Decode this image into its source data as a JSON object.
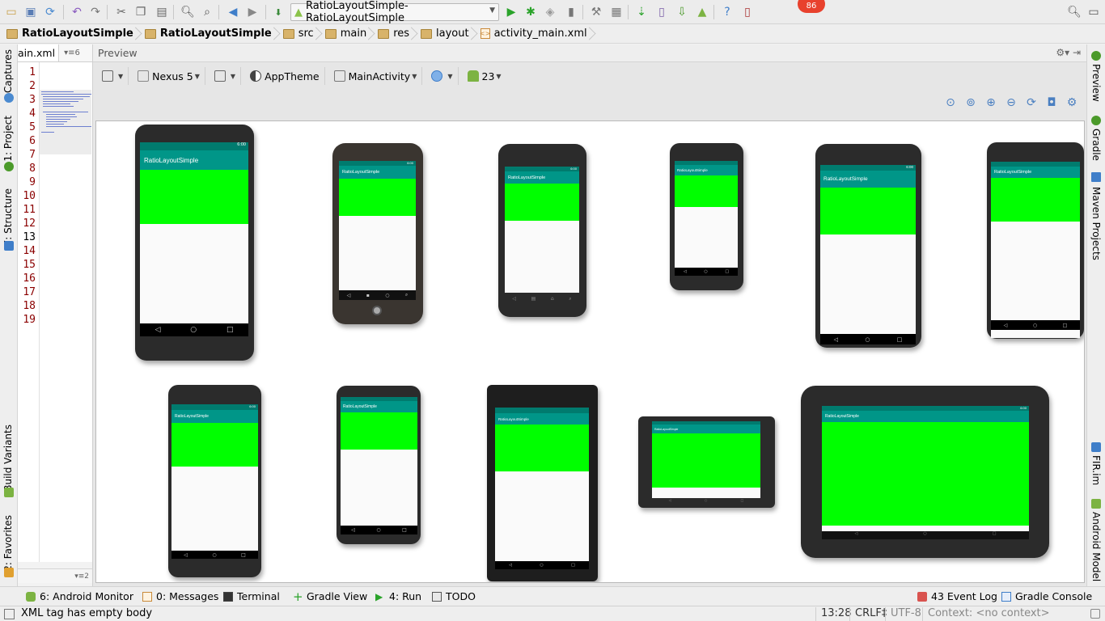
{
  "toolbar": {
    "run_config": "RatioLayoutSimple-RatioLayoutSimple",
    "notification_count": "86"
  },
  "breadcrumb": [
    {
      "label": "RatioLayoutSimple",
      "bold": true
    },
    {
      "label": "RatioLayoutSimple",
      "bold": true
    },
    {
      "label": "src",
      "bold": false
    },
    {
      "label": "main",
      "bold": false
    },
    {
      "label": "res",
      "bold": false
    },
    {
      "label": "layout",
      "bold": false
    },
    {
      "label": "activity_main.xml",
      "bold": false
    }
  ],
  "left_tool_tabs": {
    "captures": "Captures",
    "project": "1: Project",
    "structure": "7: Structure",
    "build_variants": "Build Variants",
    "favorites": "2: Favorites"
  },
  "right_tool_tabs": {
    "preview": "Preview",
    "gradle": "Gradle",
    "maven": "Maven Projects",
    "firim": "FIR.im",
    "android_model": "Android Model"
  },
  "editor": {
    "tab_name": "ain.xml",
    "line_numbers": [
      "1",
      "2",
      "3",
      "4",
      "5",
      "6",
      "7",
      "8",
      "9",
      "10",
      "11",
      "12",
      "13",
      "14",
      "15",
      "16",
      "17",
      "18",
      "19"
    ],
    "current_line": "13",
    "footer": "2"
  },
  "preview": {
    "header": "Preview",
    "device": "Nexus 5",
    "theme": "AppTheme",
    "activity": "MainActivity",
    "api_level": "23",
    "app_title": "RatioLayoutSimple",
    "status_time": "6:00"
  },
  "tool_window_bar": {
    "android_monitor": "6: Android Monitor",
    "messages": "0: Messages",
    "terminal": "Terminal",
    "gradle_view": "Gradle View",
    "run": "4: Run",
    "todo": "TODO",
    "event_log": "43 Event Log",
    "gradle_console": "Gradle Console"
  },
  "status_bar": {
    "message": "XML tag has empty body",
    "position": "13:28",
    "line_sep": "CRLF‡",
    "encoding": "UTF-8",
    "context": "Context: <no context>"
  },
  "colors": {
    "accent_green": "#00ff00",
    "action_bar": "#009688",
    "status_bar": "#007b6e",
    "badge": "#e8412d"
  }
}
